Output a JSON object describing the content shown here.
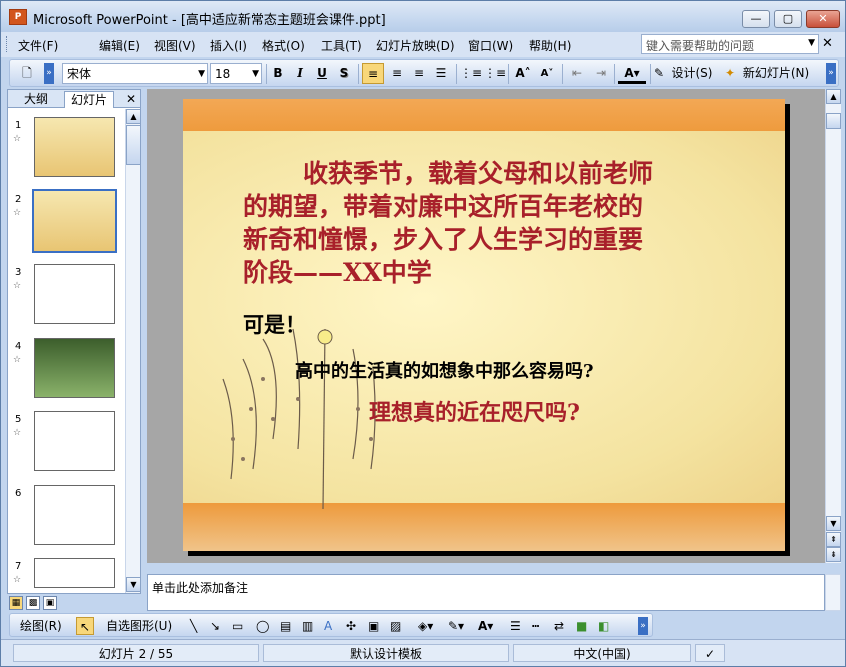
{
  "window": {
    "title": "Microsoft PowerPoint - [高中适应新常态主题班会课件.ppt]",
    "app_icon_label": "P",
    "minimize_glyph": "—",
    "restore_glyph": "▢",
    "close_glyph": "✕"
  },
  "menu": {
    "items": [
      "文件(F)",
      "编辑(E)",
      "视图(V)",
      "插入(I)",
      "格式(O)",
      "工具(T)",
      "幻灯片放映(D)",
      "窗口(W)",
      "帮助(H)"
    ],
    "help_placeholder": "键入需要帮助的问题",
    "close_doc_glyph": "✕"
  },
  "toolbar": {
    "font_name": "宋体",
    "font_size": "18",
    "bold": "B",
    "italic": "I",
    "underline": "U",
    "shadow": "S",
    "design_label": "设计(S)",
    "new_slide_label": "新幻灯片(N)"
  },
  "left_pane": {
    "tab_outline": "大纲",
    "tab_slides": "幻灯片",
    "close_glyph": "✕",
    "slides": [
      "1",
      "2",
      "3",
      "4",
      "5",
      "6",
      "7"
    ],
    "selected_slide": 2,
    "star_glyph": "☆"
  },
  "slide": {
    "para1_line1": "收获季节，载着父母和以前老师",
    "para1_line2": "的期望，带着对廉中这所百年老校的",
    "para1_line3": "新奇和憧憬，步入了人生学习的重要",
    "para1_line4": "阶段——XX中学",
    "keshi": "可是！",
    "question1": "高中的生活真的如想象中那么容易吗?",
    "question2": "理想真的近在咫尺吗?"
  },
  "notes": {
    "placeholder": "单击此处添加备注"
  },
  "draw_toolbar": {
    "draw_label": "绘图(R)",
    "autoshape_label": "自选图形(U)"
  },
  "status": {
    "slide_counter": "幻灯片 2 / 55",
    "template": "默认设计模板",
    "language": "中文(中国)"
  }
}
